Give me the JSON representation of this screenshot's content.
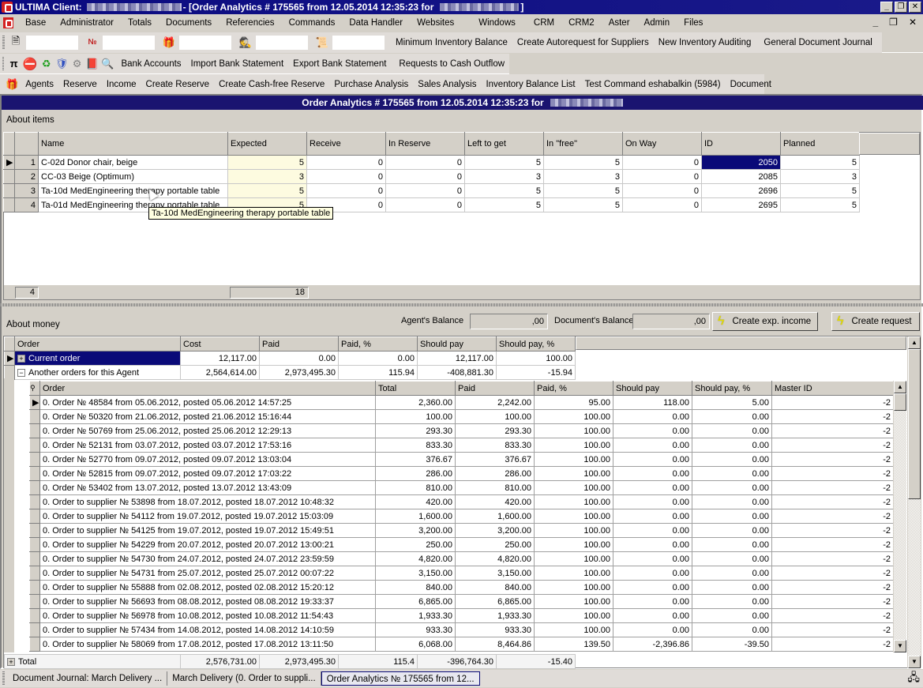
{
  "titlebar": {
    "app": "ULTIMA Client:",
    "document": "- [Order Analytics # 175565 from 12.05.2014 12:35:23 for",
    "suffix": "]",
    "buttons": {
      "minimize": "_",
      "restore": "❐",
      "close": "✕"
    }
  },
  "menu": [
    "Base",
    "Administrator",
    "Totals",
    "Documents",
    "Referencies",
    "Commands",
    "Data Handler",
    "Websites",
    "Windows",
    "CRM",
    "CRM2",
    "Aster",
    "Admin",
    "Files"
  ],
  "toolbar1": {
    "icons": [
      "document-icon",
      "numbered-document-icon",
      "gift-box-icon",
      "spy-agent-icon",
      "scroll-icon"
    ],
    "links": [
      "Minimum Inventory Balance",
      "Create Autorequest for Suppliers",
      "New Inventory Auditing",
      "General Document Journal"
    ]
  },
  "toolbar2": {
    "icons": [
      "pi-icon",
      "stop-icon",
      "refresh-icon",
      "mask-icon",
      "gear-question-icon",
      "book-icon",
      "magnifier-icon"
    ],
    "links": [
      "Bank Accounts",
      "Import Bank Statement",
      "Export Bank Statement",
      "Requests to Cash Outflow"
    ]
  },
  "toolbar3": {
    "icon": "gift-box-icon",
    "links": [
      "Agents",
      "Reserve",
      "Income",
      "Create Reserve",
      "Create Cash-free Reserve",
      "Purchase Analysis",
      "Sales Analysis",
      "Inventory Balance List",
      "Test Command eshabalkin (5984)",
      "Document"
    ]
  },
  "form": {
    "header": "Order Analytics # 175565 from 12.05.2014 12:35:23 for"
  },
  "items": {
    "section_label": "About items",
    "columns": [
      "Name",
      "Expected",
      "Receive",
      "In Reserve",
      "Left to get",
      "In \"free\"",
      "On Way",
      "ID",
      "Planned"
    ],
    "rows": [
      {
        "n": "1",
        "cells": [
          "C-02d Donor chair, beige",
          "5",
          "0",
          "0",
          "5",
          "5",
          "0",
          "2050",
          "5"
        ]
      },
      {
        "n": "2",
        "cells": [
          "CC-03 Beige (Optimum)",
          "3",
          "0",
          "0",
          "3",
          "3",
          "0",
          "2085",
          "3"
        ]
      },
      {
        "n": "3",
        "cells": [
          "Ta-10d MedEngineering therapy portable table",
          "5",
          "0",
          "0",
          "5",
          "5",
          "0",
          "2696",
          "5"
        ]
      },
      {
        "n": "4",
        "cells": [
          "Ta-01d MedEngineering therapy portable table",
          "5",
          "0",
          "0",
          "5",
          "5",
          "0",
          "2695",
          "5"
        ]
      }
    ],
    "tooltip": "Ta-10d MedEngineering therapy portable table",
    "footer_count": "4",
    "footer_expected_sum": "18"
  },
  "money": {
    "section_label": "About money",
    "agent_balance_label": "Agent's Balance",
    "agent_balance_value": ",00",
    "document_balance_label": "Document's Balance",
    "document_balance_value": ",00",
    "create_income_button": "Create exp. income",
    "create_request_button": "Create request",
    "columns": [
      "Order",
      "Cost",
      "Paid",
      "Paid, %",
      "Should pay",
      "Should pay, %"
    ],
    "groups": [
      {
        "label": "Current order",
        "expander": "+",
        "cells": [
          "12,117.00",
          "0.00",
          "0.00",
          "12,117.00",
          "100.00"
        ]
      },
      {
        "label": "Another orders for this Agent",
        "expander": "−",
        "cells": [
          "2,564,614.00",
          "2,973,495.30",
          "115.94",
          "-408,881.30",
          "-15.94"
        ]
      }
    ],
    "sub_columns": [
      "Order",
      "Total",
      "Paid",
      "Paid, %",
      "Should pay",
      "Should pay, %",
      "Master ID"
    ],
    "sub_rows": [
      [
        "0. Order № 48584 from 05.06.2012, posted 05.06.2012 14:57:25",
        "2,360.00",
        "2,242.00",
        "95.00",
        "118.00",
        "5.00",
        "-2"
      ],
      [
        "0. Order № 50320 from 21.06.2012, posted 21.06.2012 15:16:44",
        "100.00",
        "100.00",
        "100.00",
        "0.00",
        "0.00",
        "-2"
      ],
      [
        "0. Order № 50769 from 25.06.2012, posted 25.06.2012 12:29:13",
        "293.30",
        "293.30",
        "100.00",
        "0.00",
        "0.00",
        "-2"
      ],
      [
        "0. Order № 52131 from 03.07.2012, posted 03.07.2012 17:53:16",
        "833.30",
        "833.30",
        "100.00",
        "0.00",
        "0.00",
        "-2"
      ],
      [
        "0. Order № 52770 from 09.07.2012, posted 09.07.2012 13:03:04",
        "376.67",
        "376.67",
        "100.00",
        "0.00",
        "0.00",
        "-2"
      ],
      [
        "0. Order № 52815 from 09.07.2012, posted 09.07.2012 17:03:22",
        "286.00",
        "286.00",
        "100.00",
        "0.00",
        "0.00",
        "-2"
      ],
      [
        "0. Order № 53402 from 13.07.2012, posted 13.07.2012 13:43:09",
        "810.00",
        "810.00",
        "100.00",
        "0.00",
        "0.00",
        "-2"
      ],
      [
        "0. Order to supplier № 53898 from 18.07.2012, posted 18.07.2012 10:48:32",
        "420.00",
        "420.00",
        "100.00",
        "0.00",
        "0.00",
        "-2"
      ],
      [
        "0. Order to supplier № 54112 from 19.07.2012, posted 19.07.2012 15:03:09",
        "1,600.00",
        "1,600.00",
        "100.00",
        "0.00",
        "0.00",
        "-2"
      ],
      [
        "0. Order to supplier № 54125 from 19.07.2012, posted 19.07.2012 15:49:51",
        "3,200.00",
        "3,200.00",
        "100.00",
        "0.00",
        "0.00",
        "-2"
      ],
      [
        "0. Order to supplier № 54229 from 20.07.2012, posted 20.07.2012 13:00:21",
        "250.00",
        "250.00",
        "100.00",
        "0.00",
        "0.00",
        "-2"
      ],
      [
        "0. Order to supplier № 54730 from 24.07.2012, posted 24.07.2012 23:59:59",
        "4,820.00",
        "4,820.00",
        "100.00",
        "0.00",
        "0.00",
        "-2"
      ],
      [
        "0. Order to supplier № 54731 from 25.07.2012, posted 25.07.2012 00:07:22",
        "3,150.00",
        "3,150.00",
        "100.00",
        "0.00",
        "0.00",
        "-2"
      ],
      [
        "0. Order to supplier № 55888 from 02.08.2012, posted 02.08.2012 15:20:12",
        "840.00",
        "840.00",
        "100.00",
        "0.00",
        "0.00",
        "-2"
      ],
      [
        "0. Order to supplier № 56693 from 08.08.2012, posted 08.08.2012 19:33:37",
        "6,865.00",
        "6,865.00",
        "100.00",
        "0.00",
        "0.00",
        "-2"
      ],
      [
        "0. Order to supplier № 56978 from 10.08.2012, posted 10.08.2012 11:54:43",
        "1,933.30",
        "1,933.30",
        "100.00",
        "0.00",
        "0.00",
        "-2"
      ],
      [
        "0. Order to supplier № 57434 from 14.08.2012, posted 14.08.2012 14:10:59",
        "933.30",
        "933.30",
        "100.00",
        "0.00",
        "0.00",
        "-2"
      ],
      [
        "0. Order to supplier № 58069 from 17.08.2012, posted 17.08.2012 13:11:50",
        "6,068.00",
        "8,464.86",
        "139.50",
        "-2,396.86",
        "-39.50",
        "-2"
      ]
    ],
    "total": {
      "label": "Total",
      "cells": [
        "2,576,731.00",
        "2,973,495.30",
        "115.4",
        "-396,764.30",
        "-15.40"
      ]
    }
  },
  "taskbar": [
    "Document Journal: March Delivery ...",
    "March Delivery (0. Order to suppli...",
    "Order Analytics № 175565 from 12..."
  ],
  "colors": {
    "selection": "#0a0a78",
    "header_strip": "#1a1470",
    "expected_bg": "#fdfbe0"
  }
}
